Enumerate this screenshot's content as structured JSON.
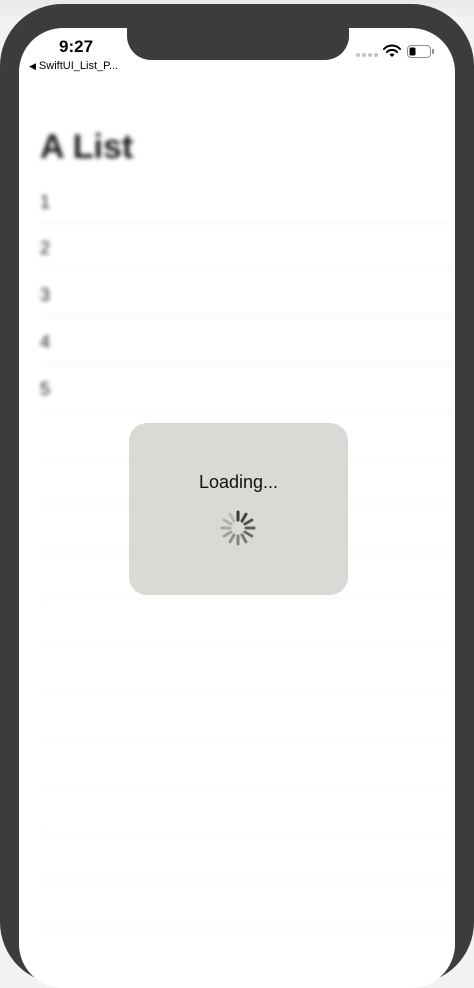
{
  "status_bar": {
    "time": "9:27",
    "back_label": "SwiftUI_List_P...",
    "back_glyph": "◀"
  },
  "list": {
    "title": "A List",
    "rows": [
      "1",
      "2",
      "3",
      "4",
      "5"
    ]
  },
  "loading": {
    "text": "Loading..."
  },
  "colors": {
    "frame": "#3c3c3c",
    "hud_background": "#d9d9d5",
    "screen": "#ffffff"
  }
}
